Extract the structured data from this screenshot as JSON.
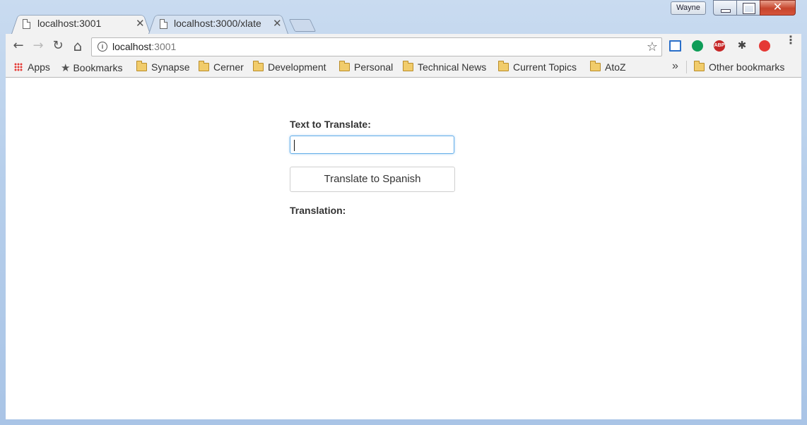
{
  "window": {
    "profile_name": "Wayne",
    "close_glyph": "✕"
  },
  "tabs": [
    {
      "title": "localhost:3001",
      "active": true
    },
    {
      "title": "localhost:3000/xlate",
      "active": false
    }
  ],
  "tab_close_glyph": "✕",
  "toolbar": {
    "back": "←",
    "forward": "→",
    "reload": "↻",
    "home": "⌂",
    "url_host": "localhost",
    "url_port": ":3001",
    "star": "☆",
    "info": "i",
    "extensions": [
      "calendar-extension-icon",
      "hangouts-icon",
      "adblock-plus-icon",
      "spider-extension-icon",
      "opera-icon"
    ],
    "menu": "⋮"
  },
  "bookmarks": {
    "items": [
      {
        "label": "Apps",
        "icon": "apps-grid-icon"
      },
      {
        "label": "Bookmarks",
        "icon": "star-icon"
      },
      {
        "label": "Synapse",
        "icon": "folder-icon"
      },
      {
        "label": "Cerner",
        "icon": "folder-icon"
      },
      {
        "label": "Development",
        "icon": "folder-icon"
      },
      {
        "label": "Personal",
        "icon": "folder-icon"
      },
      {
        "label": "Technical News",
        "icon": "folder-icon"
      },
      {
        "label": "Current Topics",
        "icon": "folder-icon"
      },
      {
        "label": "AtoZ",
        "icon": "folder-icon"
      }
    ],
    "overflow": "»",
    "other": "Other bookmarks"
  },
  "page": {
    "input_label": "Text to Translate:",
    "input_value": "",
    "button_label": "Translate to Spanish",
    "translation_label": "Translation:"
  },
  "colors": {
    "input_focus": "#66afe9",
    "folder": "#f1cc6b"
  }
}
